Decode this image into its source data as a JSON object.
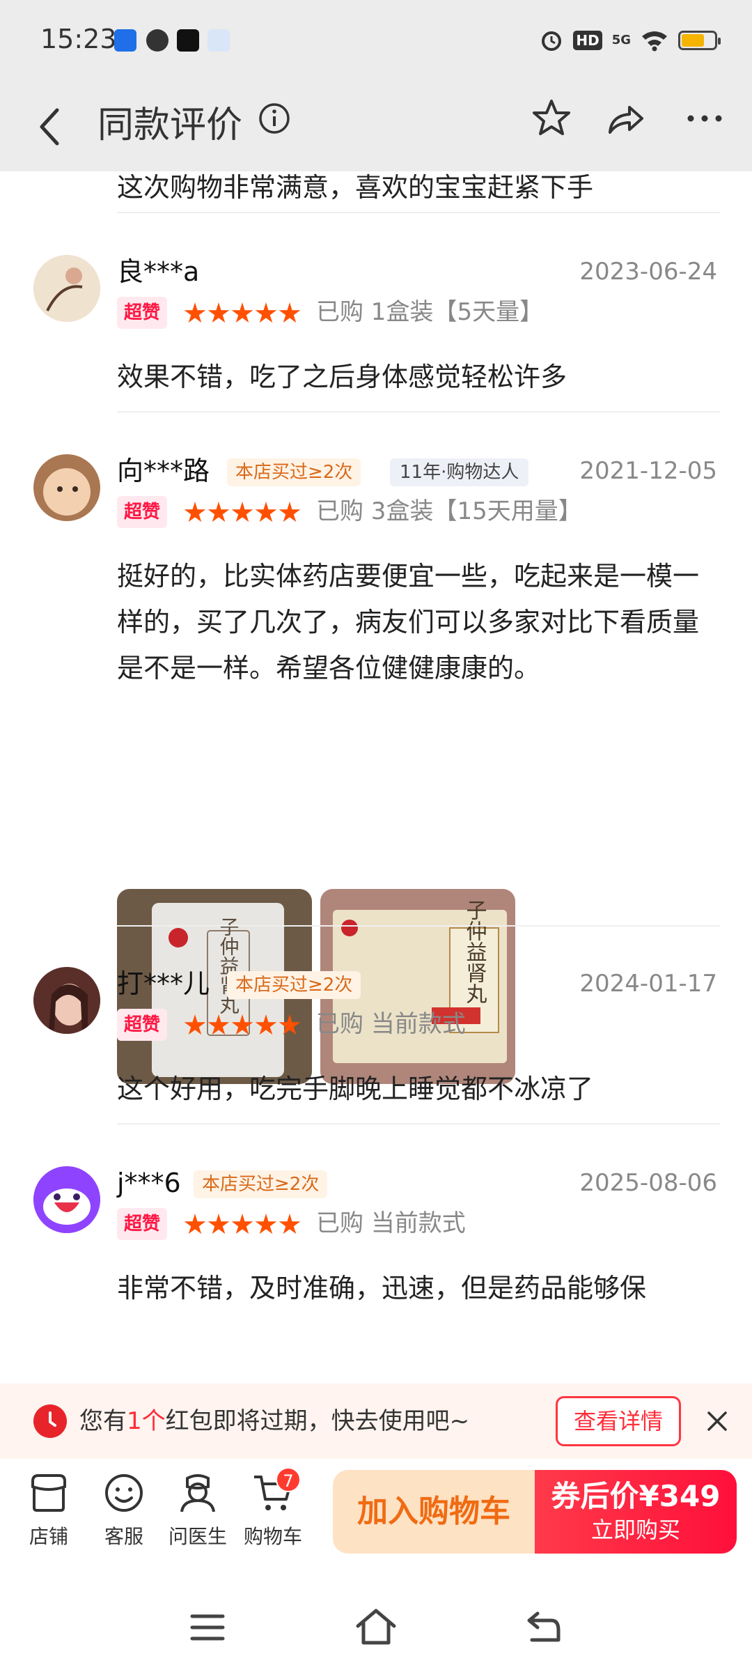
{
  "status": {
    "time": "15:23",
    "network": "5G"
  },
  "header": {
    "title": "同款评价"
  },
  "feed": {
    "partial_text": "这次购物非常满意，喜欢的宝宝赶紧下手",
    "reviews": [
      {
        "name": "良***a",
        "date": "2023-06-24",
        "badge": "超赞",
        "rating": 5,
        "purchase": "已购 1盒装【5天量】",
        "content": "效果不错，吃了之后身体感觉轻松许多",
        "avatar_color": "#e8d8c4"
      },
      {
        "name": "向***路",
        "buy_tag": "本店买过≥2次",
        "vet_tag": "11年·购物达人",
        "date": "2021-12-05",
        "badge": "超赞",
        "rating": 5,
        "purchase": "已购 3盒装【15天用量】",
        "content": "挺好的，比实体药店要便宜一些，吃起来是一模一样的，买了几次了，病友们可以多家对比下看质量是不是一样。希望各位健健康康的。",
        "avatar_color": "#f1c9a5",
        "photos": [
          {
            "kind": "sachet",
            "label": "子仲益肾丸"
          },
          {
            "kind": "box",
            "label": "子仲益肾丸"
          }
        ]
      },
      {
        "name": "打***儿",
        "buy_tag": "本店买过≥2次",
        "date": "2024-01-17",
        "badge": "超赞",
        "rating": 5,
        "purchase": "已购 当前款式",
        "content": "这个好用，吃完手脚晚上睡觉都不冰凉了",
        "avatar_color": "#6b3b32"
      },
      {
        "name": "j***6",
        "buy_tag": "本店买过≥2次",
        "date": "2025-08-06",
        "badge": "超赞",
        "rating": 5,
        "purchase": "已购 当前款式",
        "content": "非常不错，及时准确，迅速，但是药品能够保",
        "avatar_color": "#9a4bff"
      }
    ]
  },
  "banner": {
    "text_before": "您有",
    "count": "1个",
    "text_after": "红包即将过期，快去使用吧~",
    "button": "查看详情"
  },
  "bottom": {
    "nav": [
      {
        "label": "店铺",
        "icon": "store-icon"
      },
      {
        "label": "客服",
        "icon": "chat-face-icon"
      },
      {
        "label": "问医生",
        "icon": "doctor-icon"
      },
      {
        "label": "购物车",
        "icon": "cart-icon",
        "badge": "7"
      }
    ],
    "add_to_cart": "加入购物车",
    "price_text": "券后价¥349",
    "buy_now": "立即购买"
  },
  "colors": {
    "accent": "#ff5000",
    "red": "#ff1744",
    "orange": "#f06b12"
  }
}
